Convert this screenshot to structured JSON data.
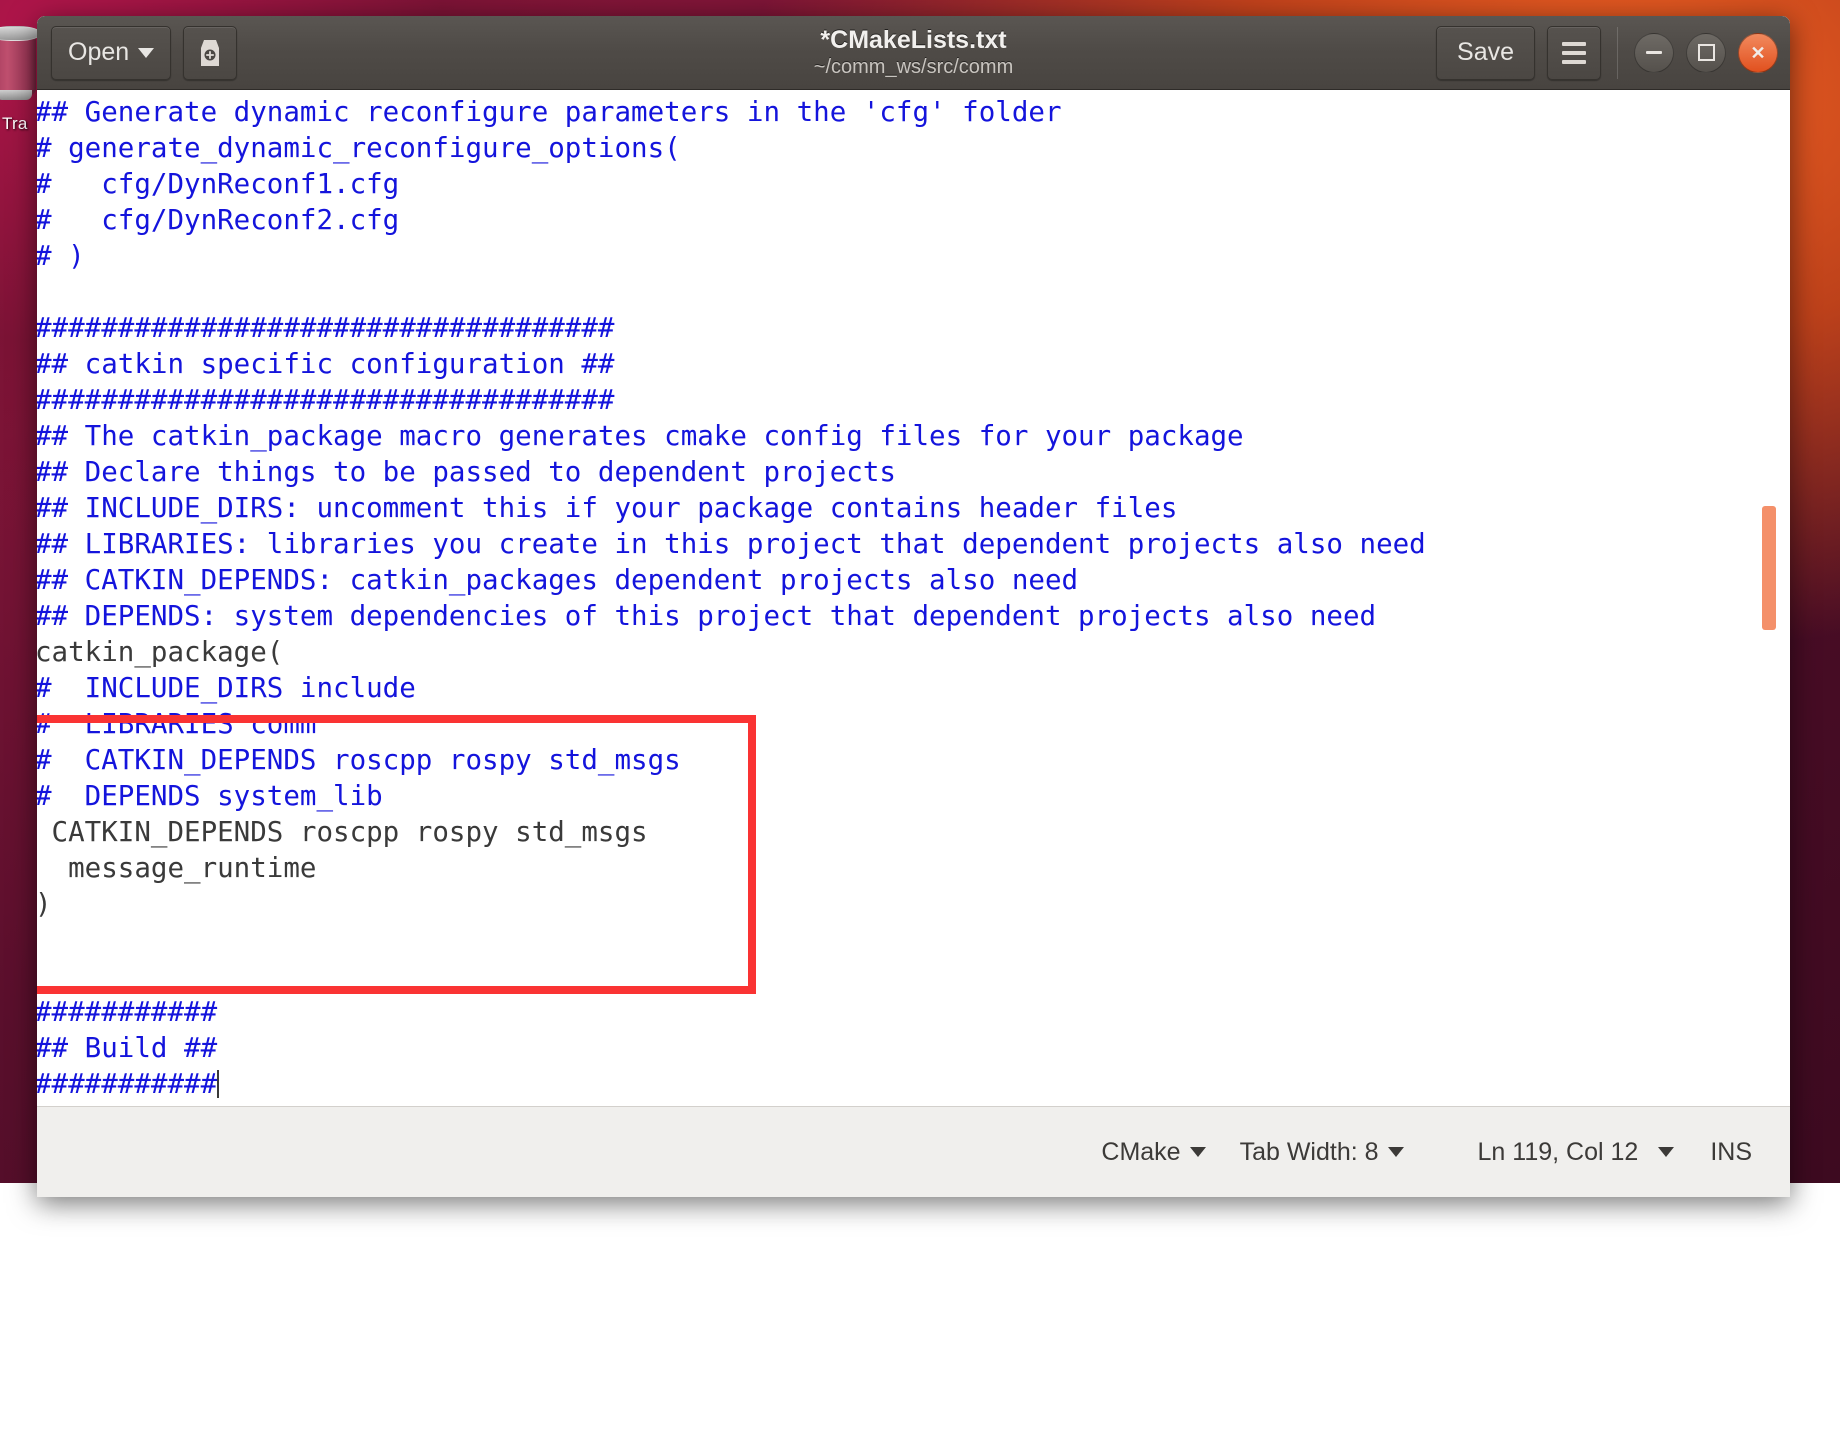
{
  "desktop": {
    "trash_label": "Tra",
    "trash_icon": "trash-icon"
  },
  "window": {
    "title": "*CMakeLists.txt",
    "subtitle": "~/comm_ws/src/comm",
    "header": {
      "open_label": "Open",
      "open_caret_icon": "chevron-down-icon",
      "new_doc_icon": "new-document-icon",
      "save_label": "Save",
      "menu_icon": "hamburger-menu-icon",
      "minimize_icon": "minimize-icon",
      "maximize_icon": "maximize-icon",
      "close_icon": "close-icon"
    }
  },
  "editor": {
    "lines": [
      {
        "text": "## Generate dynamic reconfigure parameters in the 'cfg' folder",
        "style": "comment"
      },
      {
        "text": "# generate_dynamic_reconfigure_options(",
        "style": "comment"
      },
      {
        "text": "#   cfg/DynReconf1.cfg",
        "style": "comment"
      },
      {
        "text": "#   cfg/DynReconf2.cfg",
        "style": "comment"
      },
      {
        "text": "# )",
        "style": "comment"
      },
      {
        "text": "",
        "style": "comment"
      },
      {
        "text": "###################################",
        "style": "comment"
      },
      {
        "text": "## catkin specific configuration ##",
        "style": "comment"
      },
      {
        "text": "###################################",
        "style": "comment"
      },
      {
        "text": "## The catkin_package macro generates cmake config files for your package",
        "style": "comment"
      },
      {
        "text": "## Declare things to be passed to dependent projects",
        "style": "comment"
      },
      {
        "text": "## INCLUDE_DIRS: uncomment this if your package contains header files",
        "style": "comment"
      },
      {
        "text": "## LIBRARIES: libraries you create in this project that dependent projects also need",
        "style": "comment"
      },
      {
        "text": "## CATKIN_DEPENDS: catkin_packages dependent projects also need",
        "style": "comment"
      },
      {
        "text": "## DEPENDS: system dependencies of this project that dependent projects also need",
        "style": "comment"
      },
      {
        "text": "catkin_package(",
        "style": "code"
      },
      {
        "text": "#  INCLUDE_DIRS include",
        "style": "comment"
      },
      {
        "text": "#  LIBRARIES comm",
        "style": "comment"
      },
      {
        "text": "#  CATKIN_DEPENDS roscpp rospy std_msgs",
        "style": "comment"
      },
      {
        "text": "#  DEPENDS system_lib",
        "style": "comment"
      },
      {
        "text": " CATKIN_DEPENDS roscpp rospy std_msgs",
        "style": "code"
      },
      {
        "text": "  message_runtime",
        "style": "code"
      },
      {
        "text": ")",
        "style": "code"
      },
      {
        "text": "",
        "style": "code"
      },
      {
        "text": "",
        "style": "code"
      },
      {
        "text": "###########",
        "style": "comment"
      },
      {
        "text": "## Build ##",
        "style": "comment"
      },
      {
        "text": "###########",
        "style": "comment",
        "cursor": true
      }
    ],
    "annotation": {
      "name": "red-highlight-box",
      "color": "#fa3333"
    },
    "scrollbar": {
      "thumb_color": "#f4906a"
    }
  },
  "status_bar": {
    "language": "CMake",
    "language_caret_icon": "chevron-down-icon",
    "tab_width": "Tab Width: 8",
    "tab_width_caret_icon": "chevron-down-icon",
    "position": "Ln 119, Col 12",
    "position_caret_icon": "chevron-down-icon",
    "insert_mode": "INS"
  },
  "colors": {
    "comment_blue": "#1414dc",
    "code_gray": "#3a3a3a",
    "annotation_red": "#fa3333",
    "scrollbar_orange": "#f4906a",
    "header_gray": "#4f4b47",
    "statusbar_bg": "#f0efed"
  }
}
